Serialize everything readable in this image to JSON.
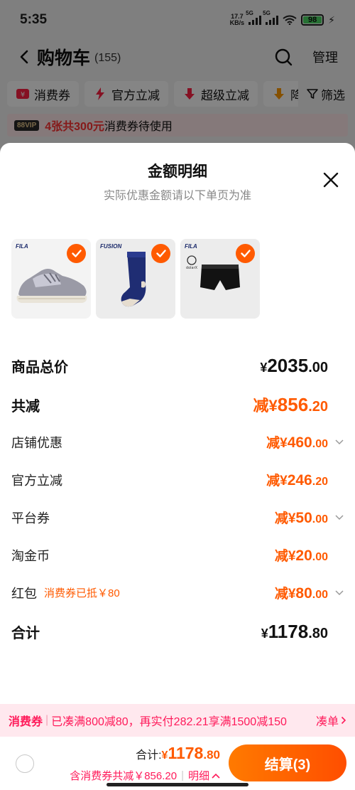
{
  "status_bar": {
    "time": "5:35",
    "net_speed_value": "17.7",
    "net_speed_unit": "KB/s",
    "sim1": "5G",
    "sim2": "5G",
    "battery": "98"
  },
  "cart_header": {
    "title": "购物车",
    "count": "(155)",
    "manage": "管理"
  },
  "filters": [
    {
      "label": "消费券",
      "icon": "coupon-icon"
    },
    {
      "label": "官方立减",
      "icon": "lightning-icon"
    },
    {
      "label": "超级立减",
      "icon": "down-arrow-icon"
    },
    {
      "label": "降",
      "icon": "down-arrow-icon"
    }
  ],
  "filter_button": "筛选",
  "coupon_banner": {
    "vip": "88VIP",
    "highlight": "4张共300元",
    "text": "消费券待使用"
  },
  "sheet": {
    "title": "金额明细",
    "subtitle": "实际优惠金额请以下单页为准",
    "products": [
      {
        "brand": "FILA",
        "name": "运动鞋"
      },
      {
        "brand": "FUSION",
        "name": "袜子"
      },
      {
        "brand": "FILA",
        "name": "内裤"
      }
    ],
    "rows": {
      "total_price": {
        "label": "商品总价",
        "yen": "¥",
        "int": "2035",
        "dec": ".00"
      },
      "total_discount": {
        "label": "共减",
        "prefix": "减¥",
        "int": "856",
        "dec": ".20"
      },
      "shop_discount": {
        "label": "店铺优惠",
        "prefix": "减¥",
        "int": "460",
        "dec": ".00"
      },
      "official_discount": {
        "label": "官方立减",
        "prefix": "减¥",
        "int": "246",
        "dec": ".20"
      },
      "platform_coupon": {
        "label": "平台券",
        "prefix": "减¥",
        "int": "50",
        "dec": ".00"
      },
      "taojinbi": {
        "label": "淘金币",
        "prefix": "减¥",
        "int": "20",
        "dec": ".00"
      },
      "red_packet": {
        "label": "红包",
        "note": "消费券已抵￥80",
        "prefix": "减¥",
        "int": "80",
        "dec": ".00"
      },
      "sum": {
        "label": "合计",
        "yen": "¥",
        "int": "1178",
        "dec": ".80"
      }
    }
  },
  "promo_bar": {
    "tag": "消费券",
    "text": "已凑满800减80，再实付282.21享满1500减150",
    "link": "凑单"
  },
  "checkout": {
    "total_label": "合计:",
    "total_yen": "¥",
    "total_int": "1178",
    "total_dec": ".80",
    "coupon_note": "含消费券共减￥856.20",
    "detail": "明细",
    "settle": "结算(3)"
  },
  "colors": {
    "accent": "#ff5a00",
    "promo": "#ff1a5a"
  }
}
